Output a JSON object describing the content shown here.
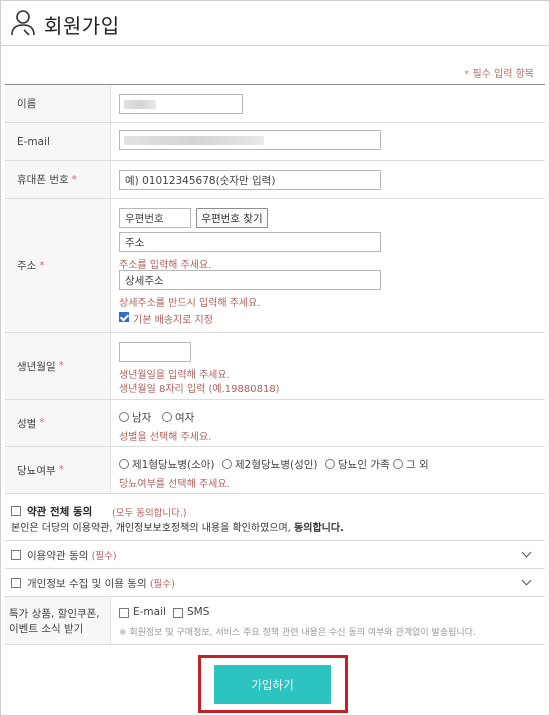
{
  "header": {
    "title": "회원가입",
    "icon": "user-icon"
  },
  "required_note": {
    "star": "*",
    "text": "필수 입력 항목"
  },
  "fields": {
    "name": {
      "label": "이름"
    },
    "email": {
      "label": "E-mail"
    },
    "phone": {
      "label": "휴대폰 번호",
      "star": "*",
      "placeholder": "예) 01012345678(숫자만 입력)"
    },
    "address": {
      "label": "주소",
      "star": "*",
      "zip_placeholder": "우편번호",
      "zip_button": "우편번호 찾기",
      "addr_placeholder": "주소",
      "addr_msg": "주소를 입력해 주세요.",
      "detail_placeholder": "상세주소",
      "detail_msg": "상세주소를 반드시 입력해 주세요.",
      "default_label": "기본 배송지로 지정",
      "default_checked": true
    },
    "birth": {
      "label": "생년월일",
      "star": "*",
      "msg1": "생년월일을 입력해 주세요.",
      "msg2": "생년월일 8자리 입력 (예.19880818)"
    },
    "gender": {
      "label": "성별",
      "star": "*",
      "options": [
        "남자",
        "여자"
      ],
      "msg": "성별을 선택해 주세요."
    },
    "diabetes": {
      "label": "당뇨여부",
      "star": "*",
      "options": [
        "제1형당뇨병(소아)",
        "제2형당뇨병(성인)",
        "당뇨인 가족",
        "그 외"
      ],
      "msg": "당뇨여부를 선택해 주세요."
    }
  },
  "agree_all": {
    "label": "약관 전체 동의",
    "note": "(모두 동의합니다.)",
    "desc_prefix": "본인은 더당의 이용약관, 개인정보보호정책의 내용을 확인하였으며,",
    "desc_bold": "동의합니다."
  },
  "agree_terms": {
    "label": "이용약관 동의",
    "req": "(필수)"
  },
  "agree_privacy": {
    "label": "개인정보 수집 및 이용 동의",
    "req": "(필수)"
  },
  "marketing": {
    "label_line1": "특가 상품, 할인쿠폰,",
    "label_line2": "이벤트 소식 받기",
    "options": [
      "E-mail",
      "SMS"
    ],
    "note": "※ 회원정보 및 구매정보, 서비스 주요 정책 관련 내용은 수신 동의 여부와 관계없이 발송됩니다."
  },
  "submit": {
    "label": "가입하기"
  },
  "colors": {
    "accent": "#2bc4c0",
    "highlight": "#c3202a",
    "error": "#b06060"
  }
}
